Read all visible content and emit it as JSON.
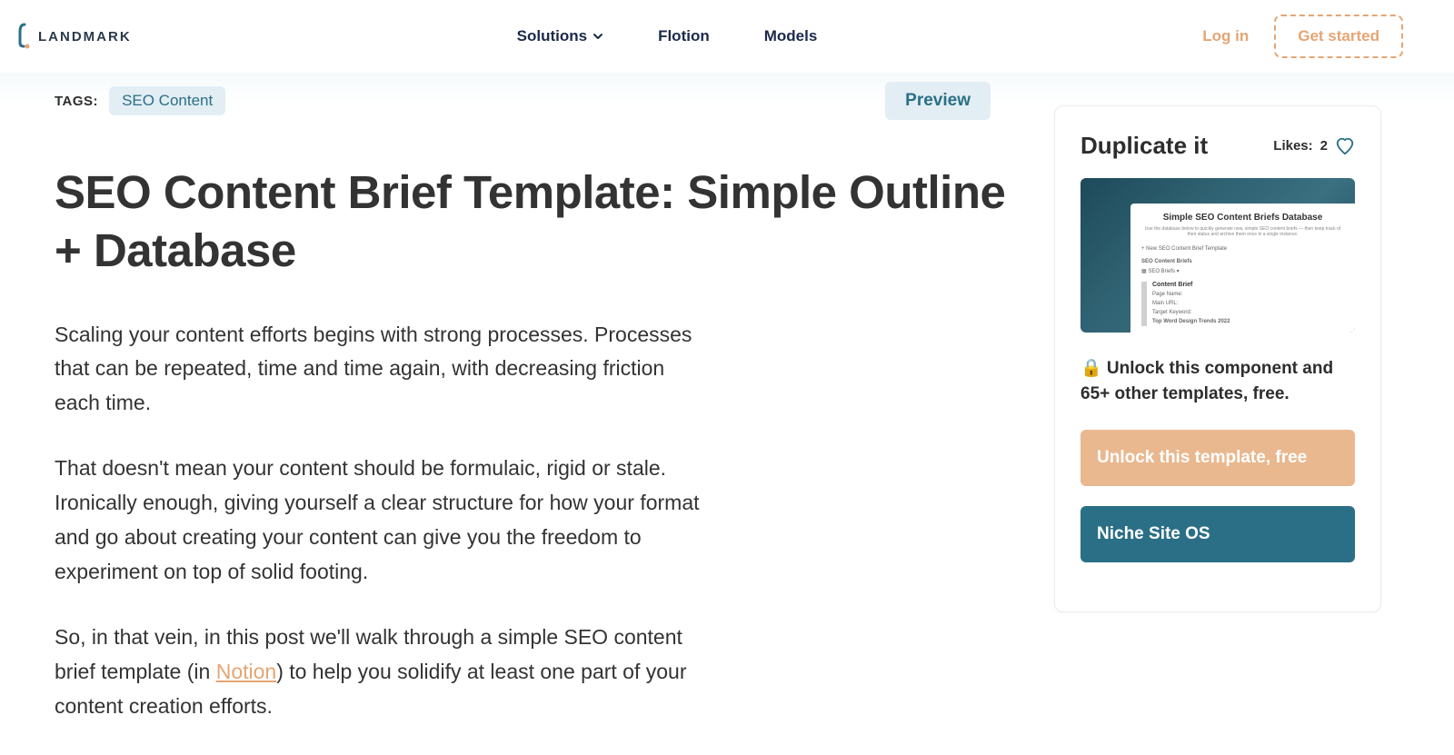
{
  "header": {
    "brand": "LANDMARK",
    "nav": {
      "solutions": "Solutions",
      "flotion": "Flotion",
      "models": "Models"
    },
    "login": "Log in",
    "get_started": "Get started"
  },
  "tags": {
    "label": "TAGS:",
    "items": [
      "SEO Content"
    ],
    "preview": "Preview"
  },
  "article": {
    "title": "SEO Content Brief Template: Simple Outline + Database",
    "p1": "Scaling your content efforts begins with strong processes. Processes that can be repeated, time and time again, with decreasing friction each time.",
    "p2": "That doesn't mean your content should be formulaic, rigid or stale. Ironically enough, giving yourself a clear structure for how your format and go about creating your content can give you the freedom to experiment on top of solid footing.",
    "p3_pre": "So, in that vein, in this post we'll walk through a simple SEO content brief template (in ",
    "p3_link": "Notion",
    "p3_post": ") to help you solidify at least one part of your content creation efforts."
  },
  "sidebar": {
    "title": "Duplicate it",
    "likes_label": "Likes:",
    "likes_count": "2",
    "thumb": {
      "title": "Simple SEO Content Briefs Database",
      "sub": "Use the database below to quickly generate new, simple SEO content briefs — then keep track of their status and archive them once in a single instance.",
      "row1": "+ New SEO Content Brief Template",
      "row2": "SEO Content Briefs",
      "row3": "▦ SEO Briefs ▾",
      "box_title": "Content Brief",
      "box_line1": "Page Name:",
      "box_line2": "Main URL:",
      "box_line3": "Target Keyword:",
      "box_line4": "Top Word Design Trends 2022"
    },
    "unlock_text": "🔒 Unlock this component and 65+ other templates, free.",
    "btn_unlock": "Unlock this template, free",
    "btn_niche": "Niche Site OS"
  }
}
